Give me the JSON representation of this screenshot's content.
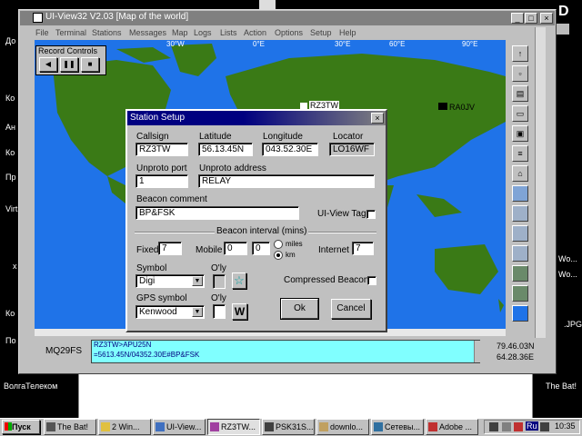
{
  "window": {
    "title": "UI-View32 V2.03 [Map of the world]",
    "menu": [
      "File",
      "Terminal",
      "Stations",
      "Messages",
      "Map",
      "Logs",
      "Lists",
      "Action",
      "Options",
      "Setup",
      "Help"
    ]
  },
  "record_controls": {
    "title": "Record Controls",
    "buttons": [
      "◀",
      "❚❚",
      "■"
    ]
  },
  "map": {
    "top_labels": [
      "30°W",
      "0°E",
      "30°E",
      "60°E",
      "90°E"
    ],
    "stations": [
      "RZ3TW",
      "RA0JV"
    ]
  },
  "desktop": {
    "left_labels": [
      "До",
      "Ко",
      "Virt",
      "x",
      "Ко",
      "Ко",
      "Пр",
      "Ан",
      "По"
    ],
    "right_labels": [
      "Wo...",
      "Wo...",
      ".JPG"
    ],
    "bottom_left": "ВолгаТелеком",
    "bottom_right": "The Bat!",
    "top_right": "D"
  },
  "dialog": {
    "title": "Station Setup",
    "callsign_label": "Callsign",
    "callsign": "RZ3TW",
    "latitude_label": "Latitude",
    "latitude": "56.13.45N",
    "longitude_label": "Longitude",
    "longitude": "043.52.30E",
    "locator_label": "Locator",
    "locator": "LO16WF",
    "unproto_port_label": "Unproto port",
    "unproto_port": "1",
    "unproto_address_label": "Unproto address",
    "unproto_address": "RELAY",
    "beacon_comment_label": "Beacon comment",
    "beacon_comment": "BP&FSK",
    "uiview_tag_label": "UI-View Tag",
    "beacon_interval_label": "Beacon interval (mins)",
    "fixed_label": "Fixed",
    "fixed": "7",
    "mobile_label": "Mobile",
    "mobile1": "0",
    "mobile2": "0",
    "miles_label": "miles",
    "km_label": "km",
    "internet_label": "Internet",
    "internet": "7",
    "symbol_label": "Symbol",
    "symbol": "Digi",
    "oly_label": "O'ly",
    "compressed_label": "Compressed Beacon",
    "gps_symbol_label": "GPS symbol",
    "gps_symbol": "Kenwood",
    "gps_oly_label": "O'ly",
    "w_symbol": "W",
    "ok_label": "Ok",
    "cancel_label": "Cancel"
  },
  "status": {
    "locator": "MQ29FS",
    "line1": "RZ3TW>APU25N",
    "line2": "=5613.45N/04352.30E#BP&FSK",
    "coord_lat": "79.46.03N",
    "coord_lon": "64.28.36E"
  },
  "taskbar": {
    "start": "Пуск",
    "tasks": [
      "The Bat!",
      "2 Win...",
      "UI-View...",
      "RZ3TW...",
      "PSK31S...",
      "downlo...",
      "Сетевы...",
      "Adobe ..."
    ],
    "lang": "Ru",
    "clock": "10:35"
  },
  "colors": {
    "ocean": "#1f73e8",
    "land": "#3a7a16",
    "titlebar": "#000080",
    "input_highlight": "#80ffff"
  }
}
